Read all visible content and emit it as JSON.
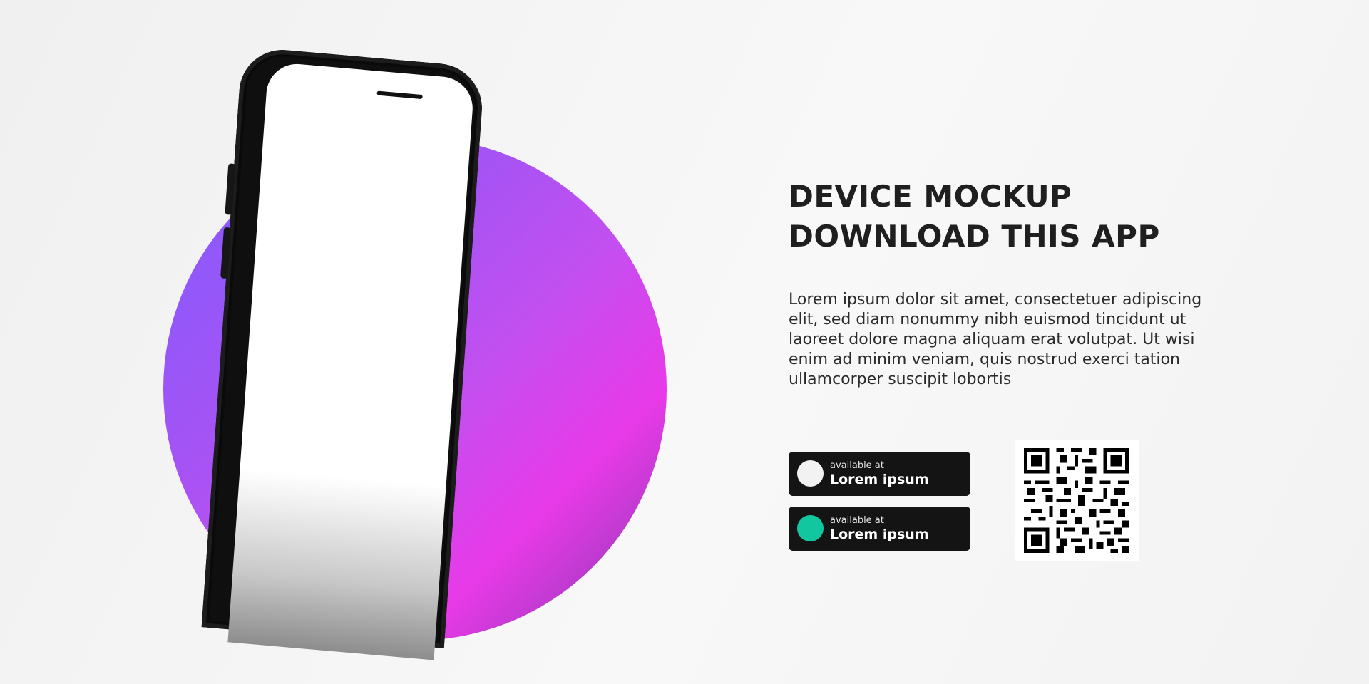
{
  "headline": {
    "line1": "DEVICE MOCKUP",
    "line2": "DOWNLOAD THIS APP"
  },
  "description": "Lorem ipsum dolor sit amet, consectetuer adipiscing elit, sed diam nonummy nibh euismod tincidunt ut laoreet dolore magna aliquam erat volutpat. Ut wisi enim ad minim veniam, quis nostrud exerci tation ullamcorper suscipit lobortis",
  "store_buttons": [
    {
      "subtitle": "available at",
      "label": "Lorem ipsum",
      "icon_color": "#f2f2f2"
    },
    {
      "subtitle": "available at",
      "label": "Lorem ipsum",
      "icon_color": "#12c7a0"
    }
  ],
  "colors": {
    "accent_purple": "#8f58ff",
    "accent_magenta": "#e83ae8",
    "button_bg": "#141414",
    "text_dark": "#1f1f1f"
  },
  "icons": {
    "store_icon_1": "store-icon",
    "store_icon_2": "store-icon",
    "qr": "qr-code-icon"
  }
}
